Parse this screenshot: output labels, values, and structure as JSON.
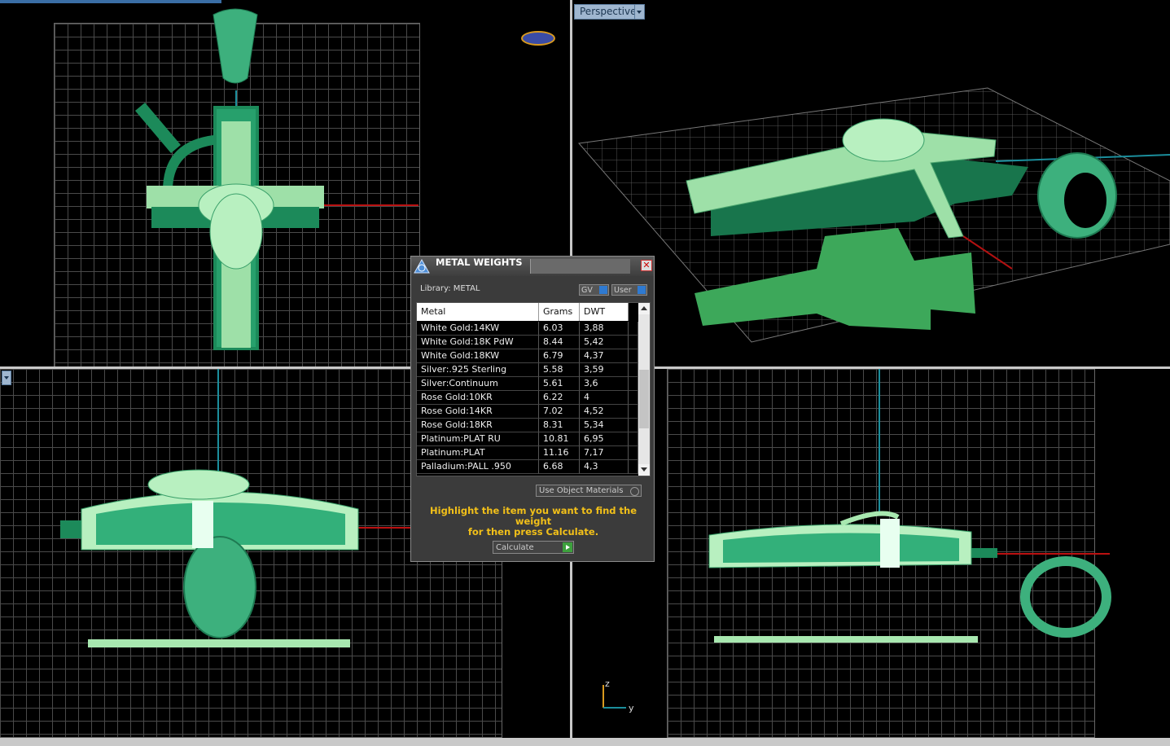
{
  "viewports": {
    "perspective_label": "Perspective"
  },
  "dialog": {
    "title": "METAL WEIGHTS",
    "close_glyph": "✕",
    "library_label": "Library: METAL",
    "toggle_gv": "GV",
    "toggle_user": "User",
    "columns": [
      "Metal",
      "Grams",
      "DWT"
    ],
    "rows": [
      [
        "White Gold:14KW",
        "6.03",
        "3,88"
      ],
      [
        "White Gold:18K PdW",
        "8.44",
        "5,42"
      ],
      [
        "White Gold:18KW",
        "6.79",
        "4,37"
      ],
      [
        "Silver:.925 Sterling",
        "5.58",
        "3,59"
      ],
      [
        "Silver:Continuum",
        "5.61",
        "3,6"
      ],
      [
        "Rose Gold:10KR",
        "6.22",
        "4"
      ],
      [
        "Rose Gold:14KR",
        "7.02",
        "4,52"
      ],
      [
        "Rose Gold:18KR",
        "8.31",
        "5,34"
      ],
      [
        "Platinum:PLAT RU",
        "10.81",
        "6,95"
      ],
      [
        "Platinum:PLAT",
        "11.16",
        "7,17"
      ],
      [
        "Palladium:PALL .950",
        "6.68",
        "4,3"
      ]
    ],
    "use_object_materials": "Use Object Materials",
    "hint_line1": "Highlight the item you want to find the weight",
    "hint_line2": "for then press Calculate.",
    "calculate_label": "Calculate"
  },
  "axis_labels": {
    "z": "z",
    "y": "y"
  },
  "colors": {
    "model_dark": "#1c8a5a",
    "model_mid": "#33b07a",
    "model_light": "#a8e8b0",
    "grid": "#4a4a4a",
    "axis_red": "#b11111",
    "axis_cyan": "#1b8e9c",
    "hint": "#f2c019"
  }
}
